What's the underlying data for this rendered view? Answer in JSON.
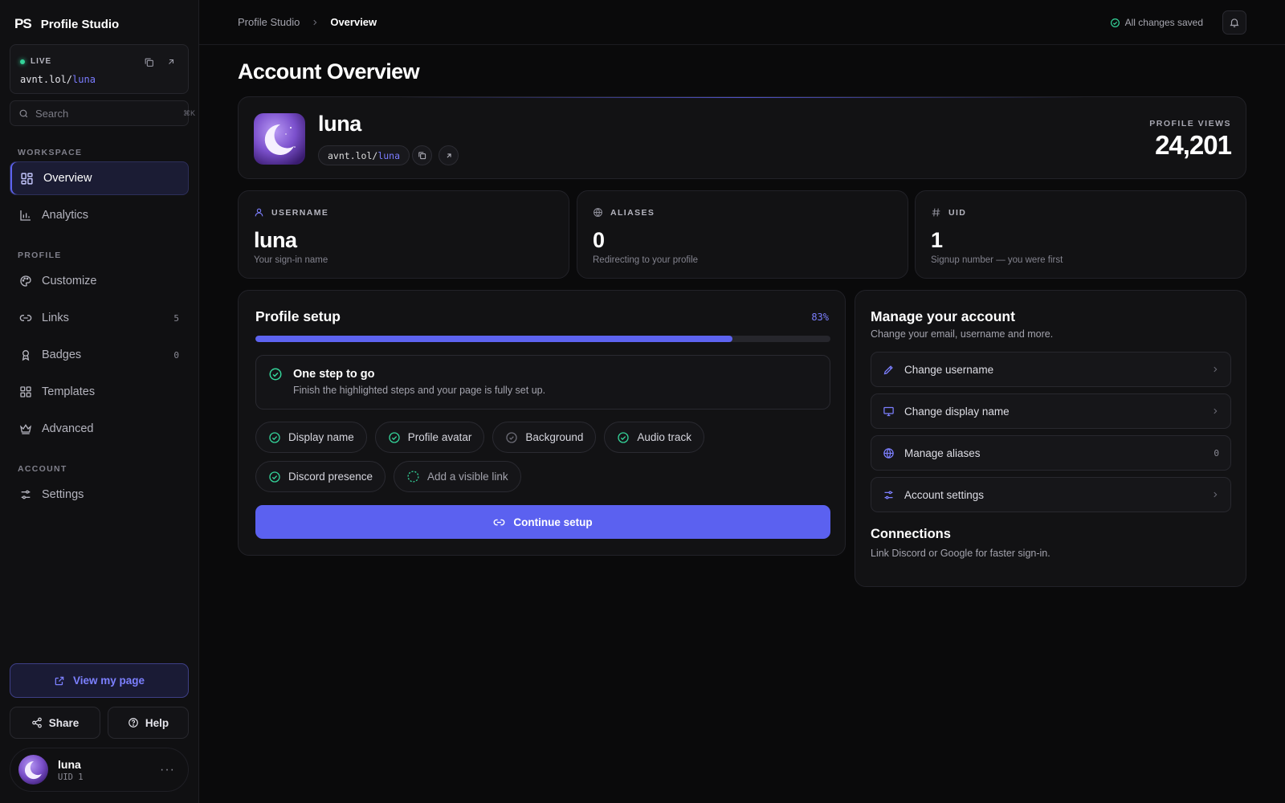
{
  "brand": {
    "logo": "PS",
    "name": "Profile Studio"
  },
  "live": {
    "label": "LIVE",
    "url_prefix": "avnt.lol/",
    "url_handle": "luna"
  },
  "search": {
    "placeholder": "Search",
    "shortcut": "⌘K"
  },
  "sidebar": {
    "sections": [
      "WORKSPACE",
      "PROFILE",
      "ACCOUNT"
    ],
    "items": [
      {
        "label": "Overview",
        "icon": "grid-icon",
        "active": true
      },
      {
        "label": "Analytics",
        "icon": "bar-chart-icon"
      },
      {
        "label": "Customize",
        "icon": "palette-icon"
      },
      {
        "label": "Links",
        "icon": "link-icon",
        "count": "5"
      },
      {
        "label": "Badges",
        "icon": "award-icon",
        "count": "0"
      },
      {
        "label": "Templates",
        "icon": "layout-icon"
      },
      {
        "label": "Advanced",
        "icon": "crown-icon"
      },
      {
        "label": "Settings",
        "icon": "sliders-icon"
      }
    ],
    "view_page": "View my page",
    "share": "Share",
    "help": "Help",
    "user": {
      "name": "luna",
      "uid": "UID 1"
    }
  },
  "topbar": {
    "crumb_root": "Profile Studio",
    "crumb_current": "Overview",
    "saved_status": "All changes saved"
  },
  "page": {
    "title": "Account Overview"
  },
  "profile": {
    "name": "luna",
    "url_prefix": "avnt.lol/",
    "url_handle": "luna",
    "views_label": "PROFILE VIEWS",
    "views_value": "24,201"
  },
  "stats": [
    {
      "label": "USERNAME",
      "value": "luna",
      "sub": "Your sign-in name",
      "icon": "user-icon"
    },
    {
      "label": "ALIASES",
      "value": "0",
      "sub": "Redirecting to your profile",
      "icon": "globe-icon"
    },
    {
      "label": "UID",
      "value": "1",
      "sub": "Signup number — you were first",
      "icon": "hash-icon"
    }
  ],
  "setup": {
    "title": "Profile setup",
    "percent_label": "83%",
    "progress": 0.83,
    "note_title": "One step to go",
    "note_sub": "Finish the highlighted steps and your page is fully set up.",
    "steps": [
      {
        "label": "Display name",
        "state": "done"
      },
      {
        "label": "Profile avatar",
        "state": "done"
      },
      {
        "label": "Background",
        "state": "optional"
      },
      {
        "label": "Audio track",
        "state": "done"
      },
      {
        "label": "Discord presence",
        "state": "done"
      },
      {
        "label": "Add a visible link",
        "state": "todo"
      }
    ],
    "continue": "Continue setup"
  },
  "manage": {
    "title": "Manage your account",
    "sub": "Change your email, username and more.",
    "rows": [
      {
        "label": "Change username",
        "icon": "pencil-icon"
      },
      {
        "label": "Change display name",
        "icon": "monitor-icon"
      },
      {
        "label": "Manage aliases",
        "icon": "globe-icon",
        "count": "0"
      },
      {
        "label": "Account settings",
        "icon": "sliders-icon"
      }
    ],
    "connections_title": "Connections",
    "connections_sub": "Link Discord or Google for faster sign-in."
  },
  "colors": {
    "accent": "#5d63f0",
    "success": "#34d399",
    "background": "#0a0a0b",
    "card": "#121214"
  }
}
